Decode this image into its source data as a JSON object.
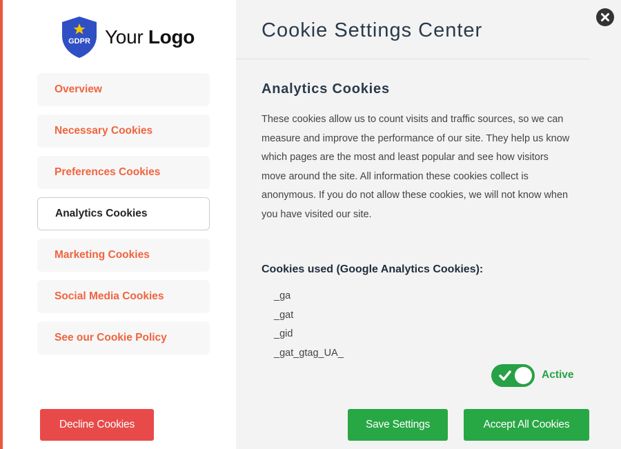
{
  "logo": {
    "badge_text": "GDPR",
    "text_light": "Your",
    "text_bold": "Logo"
  },
  "sidebar": {
    "items": [
      {
        "label": "Overview"
      },
      {
        "label": "Necessary Cookies"
      },
      {
        "label": "Preferences Cookies"
      },
      {
        "label": "Analytics Cookies",
        "active": true
      },
      {
        "label": "Marketing Cookies"
      },
      {
        "label": "Social Media Cookies"
      },
      {
        "label": "See our Cookie Policy"
      }
    ],
    "decline_label": "Decline Cookies"
  },
  "main": {
    "title": "Cookie Settings Center",
    "section_title": "Analytics Cookies",
    "description": "These cookies allow us to count visits and traffic sources, so we can measure and improve the performance of our site. They help us know which pages are the most and least popular and see how visitors move around the site. All information these cookies collect is anonymous. If you do not allow these cookies, we will not know when you have visited our site.",
    "cookies_used_title": "Cookies used (Google Analytics Cookies):",
    "cookies": [
      "_ga",
      "_gat",
      "_gid",
      "_gat_gtag_UA_"
    ],
    "toggle_state": "Active",
    "toggle_on": true,
    "save_label": "Save Settings",
    "accept_label": "Accept All Cookies"
  },
  "icons": {
    "close": "close-icon",
    "check": "check-icon",
    "shield": "gdpr-shield-icon"
  },
  "colors": {
    "accent": "#f0643f",
    "green": "#28a745",
    "decline": "#e84a4a",
    "shield": "#2f4fc4",
    "star": "#f5c400"
  }
}
